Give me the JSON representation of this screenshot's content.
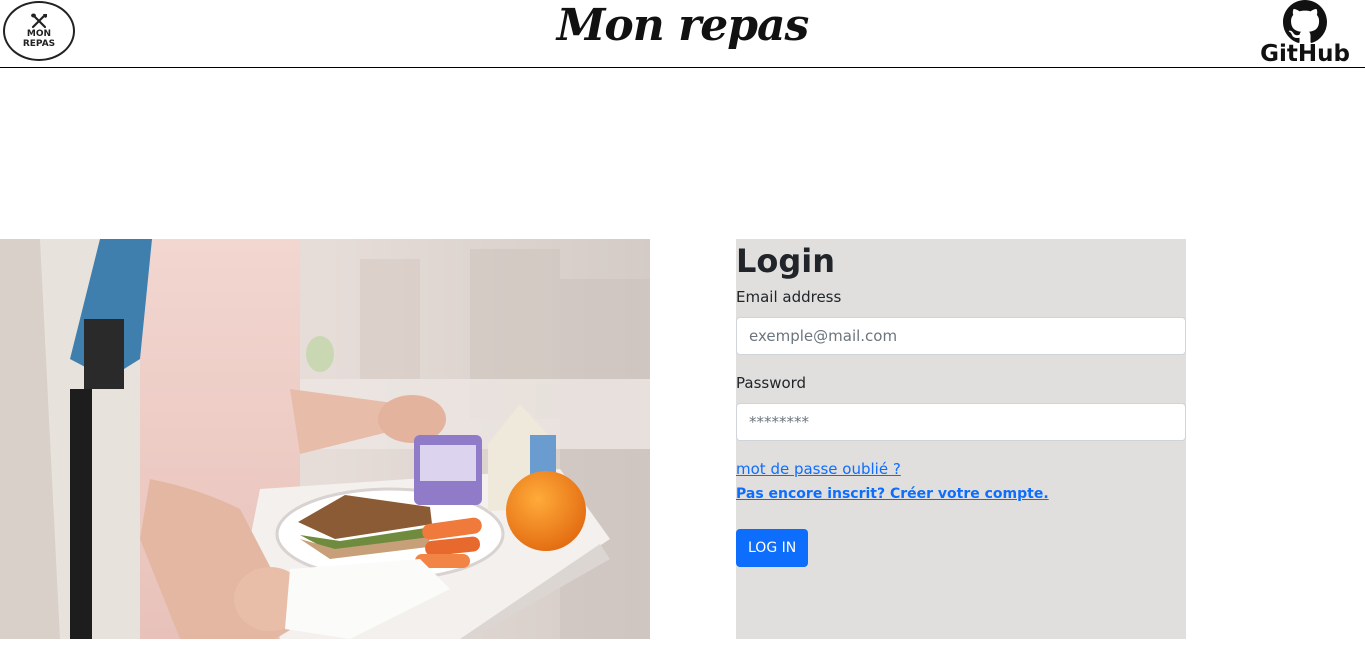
{
  "header": {
    "logo_text": "MON\nREPAS",
    "brand_title": "Mon repas",
    "github_label": "GitHub"
  },
  "hero_image": {
    "alt": "",
    "icon": "cafeteria-tray-photo"
  },
  "login": {
    "title": "Login",
    "email_label": "Email address",
    "email_placeholder": "exemple@mail.com",
    "password_label": "Password",
    "password_placeholder": "********",
    "forgot_link": "mot de passe oublié ?",
    "signup_link": "Pas encore inscrit? Créer votre compte.",
    "submit_label": "LOG IN"
  },
  "colors": {
    "panel_bg": "#e0dfde",
    "accent": "#0d6efd",
    "link": "#0d6efd"
  }
}
